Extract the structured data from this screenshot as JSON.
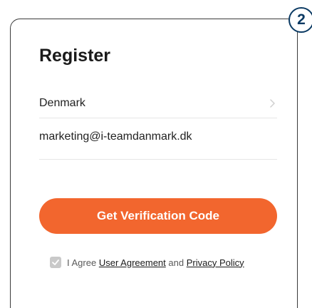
{
  "step_badge": "2",
  "register": {
    "title": "Register",
    "country_value": "Denmark",
    "email_value": "marketing@i-teamdanmark.dk",
    "cta_label": "Get Verification Code"
  },
  "agreement": {
    "checked": true,
    "prefix": "I Agree",
    "user_agreement_label": "User Agreement",
    "conjunction": "and",
    "privacy_policy_label": "Privacy Policy"
  },
  "colors": {
    "accent": "#f2662e",
    "badge": "#0b3a63"
  },
  "icons": {
    "country_chevron": "chevron-right-icon",
    "checkbox": "checkmark-icon"
  }
}
